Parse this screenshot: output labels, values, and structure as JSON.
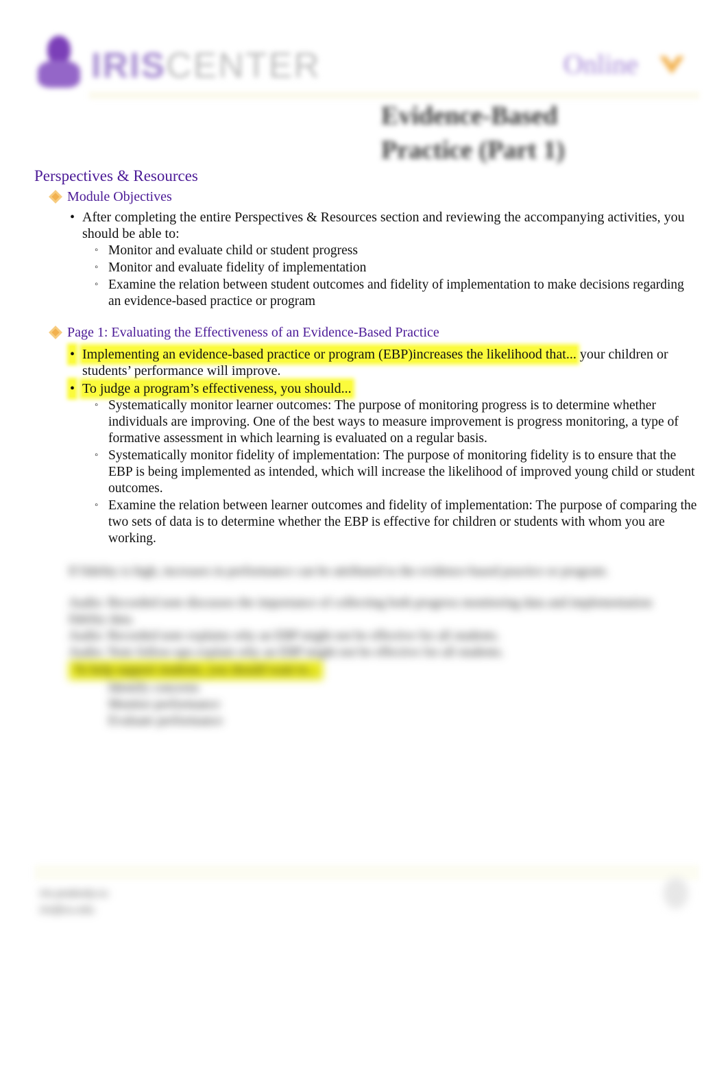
{
  "header": {
    "logo_part1": "IRIS",
    "logo_part2": "CENTER",
    "link_label": "Online",
    "doc_title": "Evidence-Based Practice (Part 1)",
    "colors": {
      "brand_purple": "#4b1a96",
      "logo_purple": "#7b3fb8",
      "accent_gold": "#f2b14e",
      "highlight": "#fbfb3c"
    }
  },
  "content": {
    "section_title": "Perspectives & Resources",
    "objectives": {
      "title": "Module Objectives",
      "intro": "After completing the entire Perspectives & Resources section and reviewing the accompanying activities, you should be able to:",
      "items": [
        "Monitor and evaluate child or student progress",
        "Monitor and evaluate fidelity of implementation",
        "Examine the relation between student outcomes and fidelity of implementation to make decisions regarding an evidence-based practice or program"
      ]
    },
    "page1": {
      "title": "Page 1: Evaluating the Effectiveness of an Evidence-Based Practice",
      "point1_highlight": "Implementing an evidence-based practice or program (EBP)increases the likelihood that...",
      "point1_rest": " your children or students’ performance will improve.",
      "point2_highlight": "To judge a program’s effectiveness, you should...",
      "items": [
        "Systematically monitor learner outcomes: The purpose of monitoring progress is to determine whether individuals are improving. One of the best ways to measure improvement is progress monitoring, a type of formative assessment in which learning is evaluated on a regular basis.",
        "Systematically monitor fidelity of implementation: The purpose of monitoring fidelity is to ensure that the EBP is being implemented as intended, which will increase the likelihood of improved young child or student outcomes.",
        "Examine the relation between learner outcomes and fidelity of implementation: The purpose of comparing the two sets of data is to determine whether the EBP is effective for children or students with whom you are working."
      ]
    },
    "blurred": {
      "line1": "If fidelity is high, increases in performance can be attributed to the evidence-based practice or program.",
      "line2": "Audio: Recorded note discusses the importance of collecting both progress monitoring data and implementation fidelity data.",
      "line3": "Audio: Recorded note explains why an EBP might not be effective for all students.",
      "line4": "Audio: Note follow-ups explain why an EBP might not be effective for all students.",
      "highlight": "To help support students, you should want to...",
      "subitems": [
        "Identify concerns",
        "Monitor performance",
        "Evaluate performance"
      ]
    }
  },
  "footer": {
    "line1": "iris.peabody.vu",
    "line2": "iris@vu.edu"
  }
}
